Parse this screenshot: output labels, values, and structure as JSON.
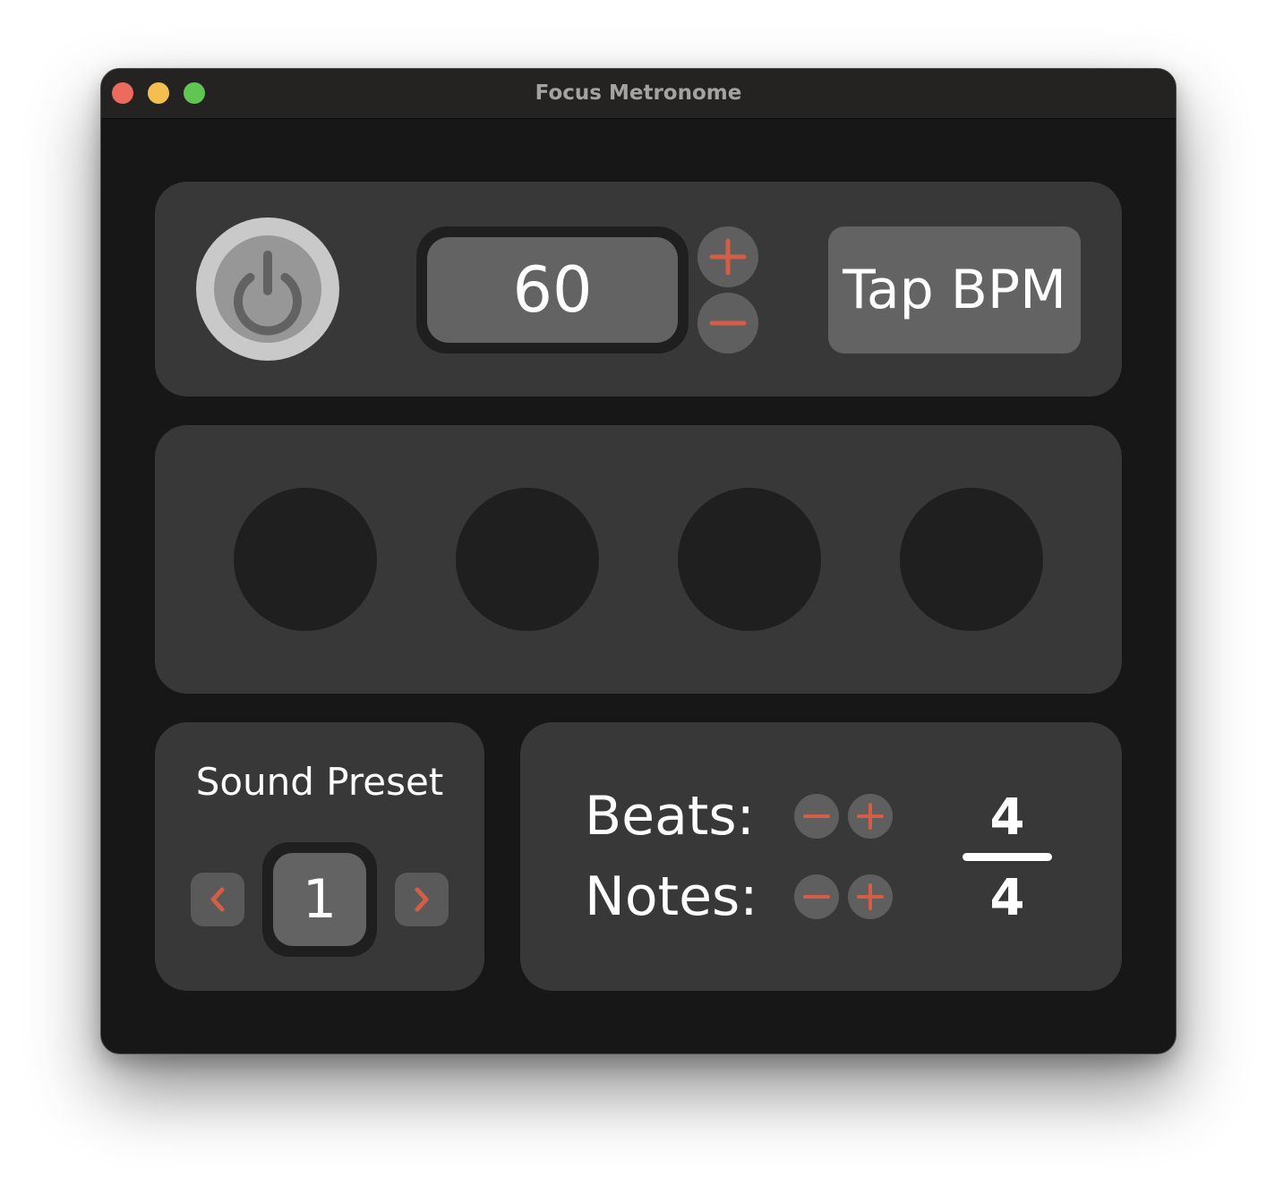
{
  "window": {
    "title": "Focus Metronome"
  },
  "controls": {
    "bpm_value": "60",
    "tap_label": "Tap BPM",
    "power_icon": "power-icon",
    "increment_icon": "plus-icon",
    "decrement_icon": "minus-icon"
  },
  "beat_indicators": {
    "count": 4,
    "active_index": null
  },
  "sound_preset": {
    "label": "Sound Preset",
    "value": "1",
    "prev_icon": "chevron-left-icon",
    "next_icon": "chevron-right-icon"
  },
  "time_signature": {
    "beats_label": "Beats:",
    "notes_label": "Notes:",
    "beats": "4",
    "notes": "4"
  },
  "colors": {
    "accent": "#d45d45",
    "window_bg": "#171717",
    "panel_bg": "#383838",
    "control_bg": "#636363",
    "beat_off": "#1f1f1f"
  }
}
